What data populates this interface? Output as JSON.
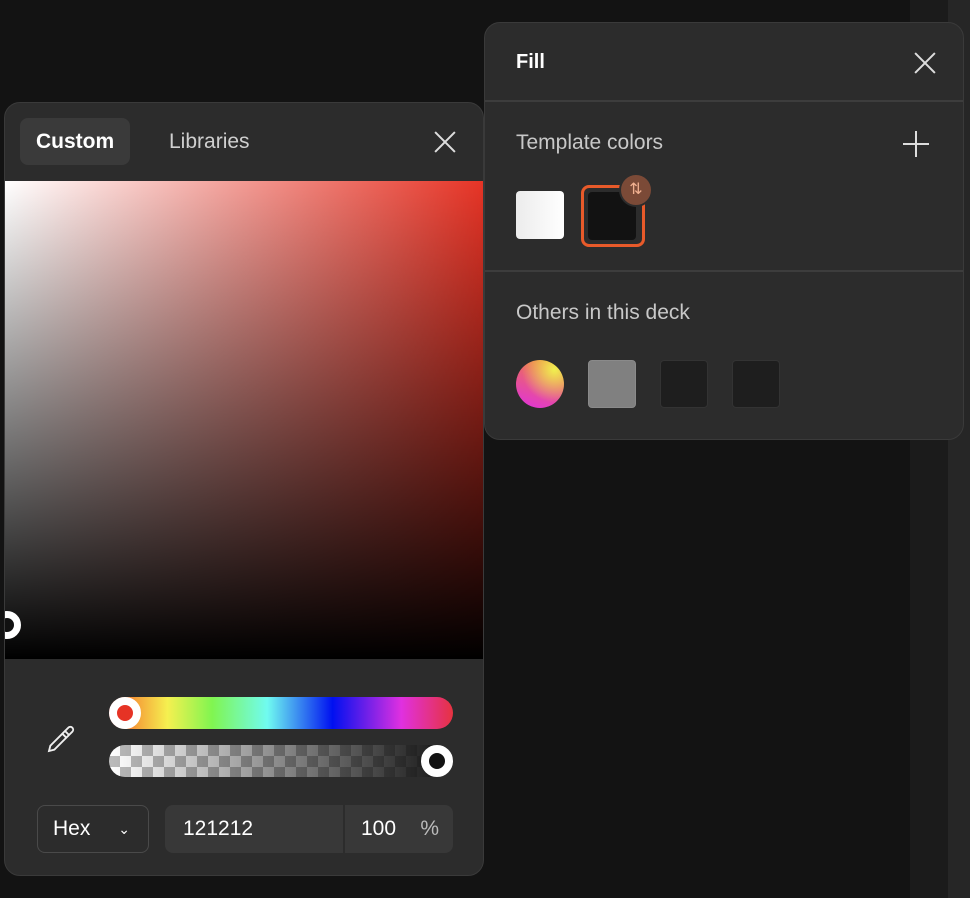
{
  "picker": {
    "tabs": [
      {
        "label": "Custom",
        "active": true
      },
      {
        "label": "Libraries",
        "active": false
      }
    ],
    "hue_color": "#e63325",
    "format": "Hex",
    "hex_value": "121212",
    "opacity": "100",
    "opacity_unit": "%"
  },
  "fill": {
    "title": "Fill",
    "template_section": "Template colors",
    "template_colors": [
      "#f5f5f5",
      "#121212"
    ],
    "selected_template": "#121212",
    "others_section": "Others in this deck",
    "others_colors": [
      "gradient",
      "#808080",
      "#1e1e1e",
      "#1e1e1e"
    ],
    "accent": "#e85a2a"
  }
}
